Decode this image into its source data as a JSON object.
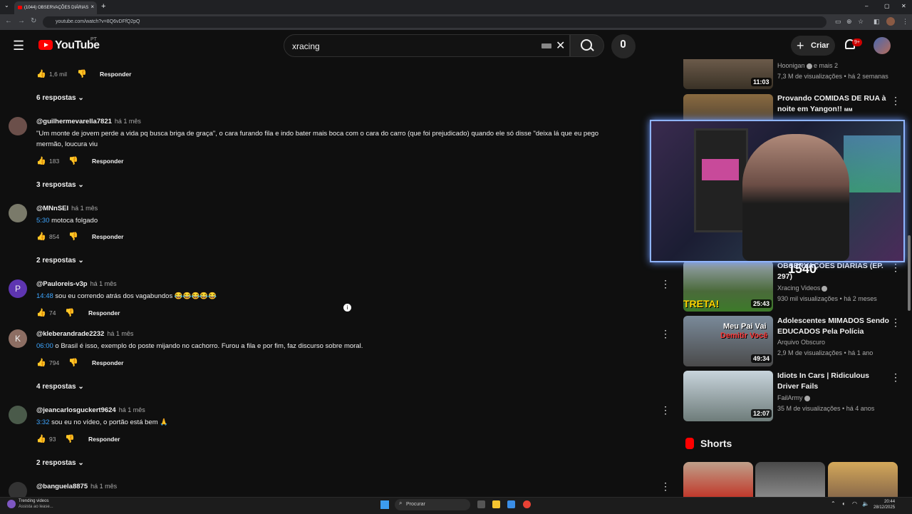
{
  "browser": {
    "tab_title": "(1044) OBSERVAÇÕES DIÁRIAS",
    "url": "youtube.com/watch?v=8Q6vDFfQ2pQ",
    "new_tab": "+",
    "tab_close": "×",
    "win_min": "–",
    "win_max": "▢",
    "win_close": "✕",
    "back": "←",
    "forward": "→",
    "reload": "↻"
  },
  "header": {
    "wordmark": "YouTube",
    "country": "PT",
    "search_value": "xracing",
    "create_label": "Criar",
    "notif_count": "9+"
  },
  "comments": {
    "top_likes": "1,6 mil",
    "reply_label": "Responder",
    "items": [
      {
        "author": "@guilhermevarella7821",
        "time": "há 1 mês",
        "text1": "\"Um monte de jovem perde a vida pq busca briga de graça\", o cara furando fila e indo bater mais boca com o cara do carro (que foi prejudicado) quando ele só disse \"deixa lá que eu pego",
        "text2": "mermão, loucura viu",
        "likes": "183",
        "replies": "3 respostas"
      },
      {
        "author": "@MNnSEI",
        "time": "há 1 mês",
        "ts": "5:30",
        "text": " motoca folgado",
        "likes": "854",
        "replies": "2 respostas"
      },
      {
        "author": "@Pauloreis-v3p",
        "time": "há 1 mês",
        "ts": "14:48",
        "text": " sou eu correndo atrás dos vagabundos 😂😂😂😂😂",
        "likes": "74",
        "initial": "P"
      },
      {
        "author": "@kleberandrade2232",
        "time": "há 1 mês",
        "ts": "06:00",
        "text": " o Brasil é isso, exemplo do poste mijando no cachorro. Furou a fila e por fim, faz discurso sobre moral.",
        "likes": "794",
        "replies": "4 respostas",
        "initial": "K"
      },
      {
        "author": "@jeancarlosguckert9624",
        "time": "há 1 mês",
        "ts": "3:32",
        "text": " sou eu no vídeo, o portão está bem 🙏",
        "likes": "93",
        "replies": "2 respostas"
      },
      {
        "author": "@banguela8875",
        "time": "há 1 mês"
      }
    ],
    "top_replies": "6 respostas"
  },
  "sidebar": {
    "videos": [
      {
        "channel": "Hoonigan",
        "extra": "e mais 2",
        "views": "7,3 M de visualizações",
        "age": "há 2 semanas",
        "duration": "11:03"
      },
      {
        "title": "Provando COMIDAS DE RUA à noite em Yangon!!",
        "channel_tag": "ᴍᴍ"
      },
      {
        "title": "OBSERVAÇÕES DIÁRIAS (EP. 297)",
        "channel": "Xracing Videos",
        "views": "930 mil visualizações",
        "age": "há 2 meses",
        "duration": "25:43",
        "badge": "TRETA!"
      },
      {
        "title": "Adolescentes MIMADOS Sendo EDUCADOS Pela Polícia",
        "channel": "Arquivo Obscuro",
        "views": "2,9 M de visualizações",
        "age": "há 1 ano",
        "duration": "49:34",
        "thumb_text1": "Meu Pai Vai",
        "thumb_text2": "Demitir Você"
      },
      {
        "title": "Idiots In Cars | Ridiculous Driver Fails",
        "channel": "FailArmy",
        "views": "35 M de visualizações",
        "age": "há 4 anos",
        "duration": "12:07"
      }
    ],
    "shorts_title": "Shorts",
    "overlay_counter": "1540"
  },
  "taskbar": {
    "search_placeholder": "Procurar",
    "news_title": "Trending videos",
    "news_sub": "Assista ao lease...",
    "time": "20:44",
    "date": "28/12/2025"
  }
}
